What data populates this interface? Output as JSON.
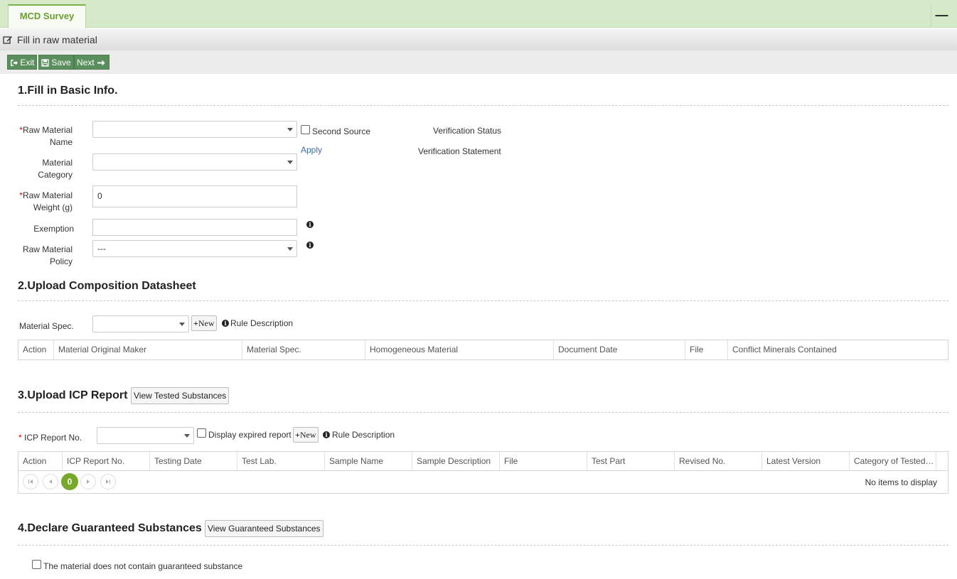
{
  "tab": {
    "label": "MCD Survey"
  },
  "subheader": {
    "title": "Fill in raw material"
  },
  "toolbar": {
    "exit": "Exit",
    "save": "Save",
    "next": "Next"
  },
  "section1": {
    "title": "1.Fill in Basic Info.",
    "raw_material_name_label_1": "Raw Material",
    "raw_material_name_label_2": "Name",
    "second_source": "Second Source",
    "apply": "Apply",
    "verification_status": "Verification Status",
    "verification_statement": "Verification Statement",
    "material_category_label_1": "Material",
    "material_category_label_2": "Category",
    "weight_label_1": "Raw Material",
    "weight_label_2": "Weight (g)",
    "weight_value": "0",
    "exemption_label": "Exemption",
    "policy_label_1": "Raw Material",
    "policy_label_2": "Policy",
    "policy_value": "---"
  },
  "section2": {
    "title": "2.Upload Composition Datasheet",
    "material_spec_label": "Material Spec.",
    "new": "New",
    "rule_description": "Rule Description",
    "columns": [
      "Action",
      "Material Original Maker",
      "Material Spec.",
      "Homogeneous Material",
      "Document Date",
      "File",
      "Conflict Minerals Contained"
    ]
  },
  "section3": {
    "title": "3.Upload ICP Report",
    "view_button": "View Tested Substances",
    "icp_label": "ICP Report No.",
    "display_expired": "Display expired report",
    "new": "New",
    "rule_description": "Rule Description",
    "columns": [
      "Action",
      "ICP Report No.",
      "Testing Date",
      "Test Lab.",
      "Sample Name",
      "Sample Description",
      "File",
      "Test Part",
      "Revised No.",
      "Latest Version",
      "Category of Tested Substances"
    ],
    "pager_current": "0",
    "no_items": "No items to display"
  },
  "section4": {
    "title": "4.Declare Guaranteed Substances",
    "view_button": "View Guaranteed Substances",
    "no_guaranteed": "The material does not contain guaranteed substance"
  }
}
